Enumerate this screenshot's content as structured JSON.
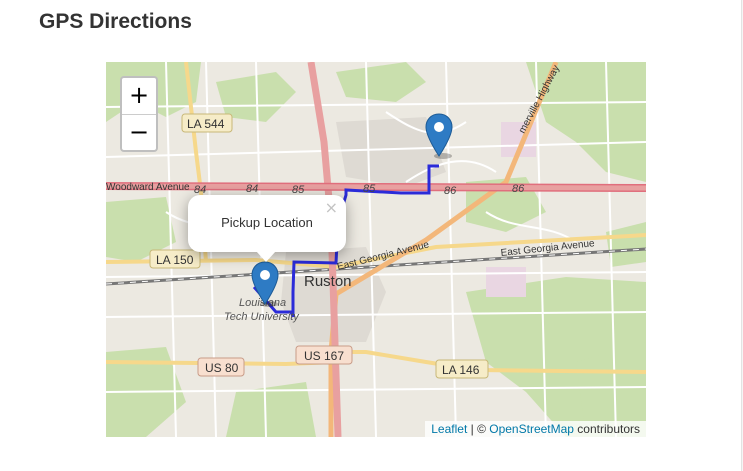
{
  "page": {
    "title": "GPS Directions"
  },
  "map": {
    "zoom_in_label": "+",
    "zoom_out_label": "−",
    "popup": {
      "text": "Pickup Location",
      "close_label": "×"
    },
    "attribution": {
      "leaflet": "Leaflet",
      "separator": " | © ",
      "osm": "OpenStreetMap",
      "suffix": " contributors"
    },
    "labels": {
      "la544": "LA 544",
      "la150": "LA 150",
      "us80": "US 80",
      "us167": "US 167",
      "la146": "LA 146",
      "ruston": "Ruston",
      "woodward": "Woodward Avenue",
      "east_georgia_1": "East Georgia Avenue",
      "east_georgia_2": "East Georgia Avenue",
      "louisiana": "Louisiana",
      "tech": "Tech University",
      "merville": "merville Highway",
      "n84a": "84",
      "n84b": "84",
      "n85a": "85",
      "n85b": "85",
      "n86a": "86",
      "n86b": "86"
    },
    "colors": {
      "route": "#2b2bd9",
      "marker": "#2e7bc4",
      "highway": "#e8a0a0",
      "primary": "#f6d88b"
    }
  }
}
